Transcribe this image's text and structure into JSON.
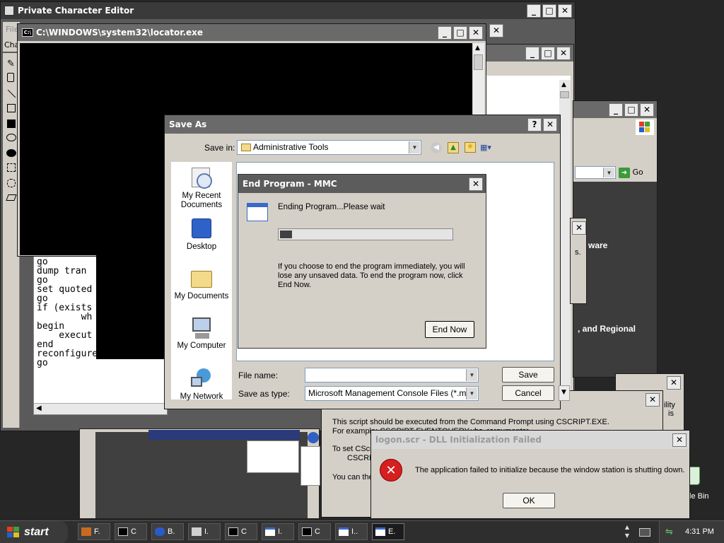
{
  "pce": {
    "title": "Private Character Editor",
    "menu_file": "File",
    "menu_char": "Cha"
  },
  "cmd": {
    "title": "C:\\WINDOWS\\system32\\locator.exe"
  },
  "script": {
    "lines": [
      "go",
      "dump tran",
      "go",
      "",
      "set quoted",
      "go",
      "",
      "if (exists",
      "        wh",
      "begin",
      "    execut",
      "end",
      "reconfigure with overri",
      "go"
    ]
  },
  "back1": {},
  "ie": {
    "go_label": "Go"
  },
  "ctrl": {
    "text1": "ware",
    "text2": "s.",
    "text3": ", and Regional"
  },
  "side": {
    "t1": "ility",
    "t2": "is",
    "t3": "le Bin"
  },
  "saveas": {
    "title": "Save As",
    "save_in_label": "Save in:",
    "save_in_value": "Administrative Tools",
    "places": [
      {
        "label": "My Recent Documents"
      },
      {
        "label": "Desktop"
      },
      {
        "label": "My Documents"
      },
      {
        "label": "My Computer"
      },
      {
        "label": "My Network"
      }
    ],
    "file_name_label": "File name:",
    "file_name_value": "",
    "save_type_label": "Save as type:",
    "save_type_value": "Microsoft Management Console Files (*.msc)",
    "save_button": "Save",
    "cancel_button": "Cancel"
  },
  "endprog": {
    "title": "End Program - MMC",
    "status": "Ending Program...Please wait",
    "progress": 0.07,
    "message": "If you choose to end the program immediately, you will lose any unsaved data. To end the program now, click End Now.",
    "end_now_button": "End Now"
  },
  "cscript": {
    "line1": "This script should be executed from the Command Prompt using CSCRIPT.EXE.",
    "line2": "For example: CSCRIPT EVENTQUERY.vbs <arguments>",
    "line3": "To set CScri",
    "line4": "CSCRI",
    "line5": "You can the"
  },
  "logon": {
    "title": "logon.scr - DLL Initialization Failed",
    "message": "The application failed to initialize because the window station is shutting down.",
    "ok_button": "OK"
  },
  "taskbar": {
    "start_label": "start",
    "items": [
      {
        "label": "F."
      },
      {
        "label": "C"
      },
      {
        "label": "B."
      },
      {
        "label": "I."
      },
      {
        "label": "C"
      },
      {
        "label": "I."
      },
      {
        "label": "C"
      },
      {
        "label": "I.."
      },
      {
        "label": "E."
      }
    ],
    "clock": "4:31 PM"
  },
  "colors": {
    "xp_green": "#3c8c3c",
    "error_red": "#d42020",
    "progress_block": "#404040"
  }
}
